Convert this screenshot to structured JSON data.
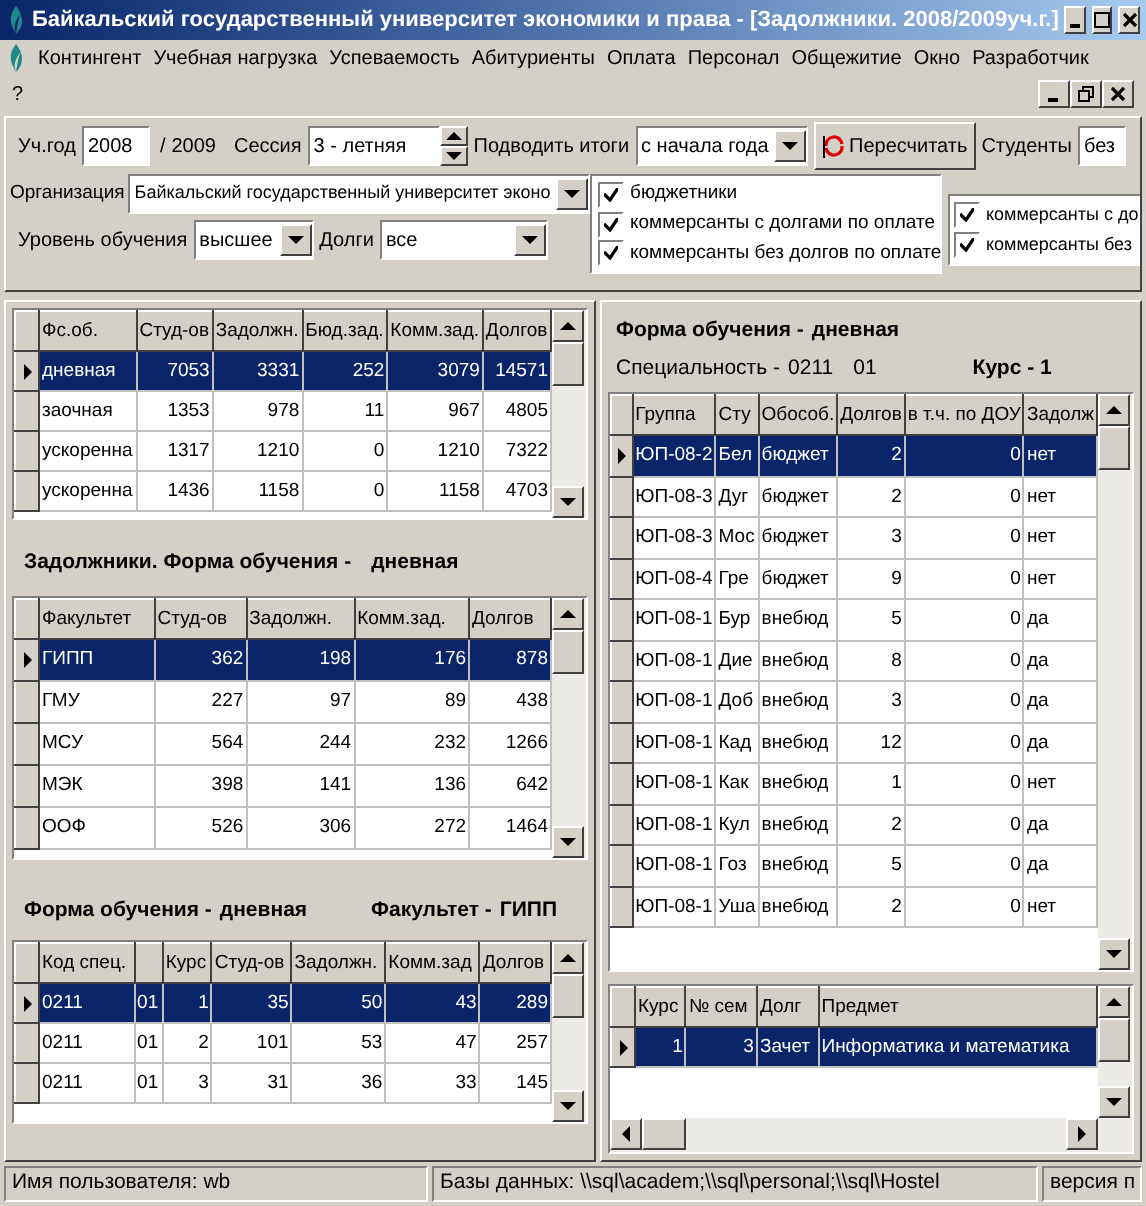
{
  "window": {
    "title": "Байкальский государственный университет экономики и права - [Задолжники. 2008/2009уч.г.]"
  },
  "menu": [
    "Контингент",
    "Учебная нагрузка",
    "Успеваемость",
    "Абитуриенты",
    "Оплата",
    "Персонал",
    "Общежитие",
    "Окно",
    "Разработчик"
  ],
  "menu_help": "?",
  "filters": {
    "year_label": "Уч.год",
    "year": "2008",
    "year_sep": "/",
    "year_end": "2009",
    "session_label": "Сессия",
    "session": "3 - летняя",
    "totals_label": "Подводить итоги",
    "totals": "с начала года",
    "recalc_button": "Пересчитать",
    "students_label": "Студенты",
    "students": "без",
    "org_label": "Организация",
    "org": "Байкальский государственный университет эконо",
    "level_label": "Уровень обучения",
    "level": "высшее",
    "debts_label": "Долги",
    "debts": "все"
  },
  "checkboxes": [
    {
      "label": "бюджетники",
      "checked": true
    },
    {
      "label": "коммерсанты с долгами по оплате",
      "checked": true
    },
    {
      "label": "коммерсанты без долгов по оплате",
      "checked": true
    }
  ],
  "checkboxes_2": [
    {
      "label": "коммерсанты с до",
      "checked": true
    },
    {
      "label": "коммерсанты без",
      "checked": true
    }
  ],
  "forms_table": {
    "columns": [
      "Фс.об.",
      "Студ-ов",
      "Задолжн.",
      "Бюд.зад.",
      "Комм.зад.",
      "Долгов"
    ],
    "rows": [
      {
        "cells": [
          "дневная",
          "7053",
          "3331",
          "252",
          "3079",
          "14571"
        ],
        "selected": true
      },
      {
        "cells": [
          "заочная",
          "1353",
          "978",
          "11",
          "967",
          "4805"
        ],
        "selected": false
      },
      {
        "cells": [
          "ускоренна",
          "1317",
          "1210",
          "0",
          "1210",
          "7322"
        ],
        "selected": false
      },
      {
        "cells": [
          "ускоренна",
          "1436",
          "1158",
          "0",
          "1158",
          "4703"
        ],
        "selected": false
      }
    ]
  },
  "faculty_caption": {
    "text": "Задолжники. Форма обучения -",
    "value": "дневная"
  },
  "faculty_table": {
    "columns": [
      "Факультет",
      "Студ-ов",
      "Задолжн.",
      "Комм.зад.",
      "Долгов"
    ],
    "rows": [
      {
        "cells": [
          "ГИПП",
          "362",
          "198",
          "176",
          "878"
        ],
        "selected": true
      },
      {
        "cells": [
          "ГМУ",
          "227",
          "97",
          "89",
          "438"
        ],
        "selected": false
      },
      {
        "cells": [
          "МСУ",
          "564",
          "244",
          "232",
          "1266"
        ],
        "selected": false
      },
      {
        "cells": [
          "МЭК",
          "398",
          "141",
          "136",
          "642"
        ],
        "selected": false
      },
      {
        "cells": [
          "ООФ",
          "526",
          "306",
          "272",
          "1464"
        ],
        "selected": false
      }
    ]
  },
  "spec_caption": {
    "form_label": "Форма обучения -",
    "form": "дневная",
    "faculty_label": "Факультет -",
    "faculty": "ГИПП"
  },
  "spec_table": {
    "columns": [
      "Код спец.",
      "",
      "Курс",
      "Студ-ов",
      "Задолжн.",
      "Комм.зад",
      "Долгов"
    ],
    "rows": [
      {
        "cells": [
          "0211",
          "01",
          "1",
          "35",
          "50",
          "43",
          "289"
        ],
        "selected": true
      },
      {
        "cells": [
          "0211",
          "01",
          "2",
          "101",
          "53",
          "47",
          "257"
        ],
        "selected": false
      },
      {
        "cells": [
          "0211",
          "01",
          "3",
          "31",
          "36",
          "33",
          "145"
        ],
        "selected": false
      }
    ]
  },
  "group_caption": {
    "form_label": "Форма обучения -",
    "form": "дневная",
    "spec_label": "Специальность -",
    "spec": "0211",
    "spec_sub": "01",
    "course": "Курс - 1"
  },
  "group_table": {
    "columns": [
      "Группа",
      "Сту",
      "Обособ.",
      "Долгов",
      "в т.ч. по ДОУ",
      "Задолж"
    ],
    "rows": [
      {
        "cells": [
          "ЮП-08-2",
          "Бел",
          "бюджет",
          "2",
          "0",
          "нет"
        ],
        "selected": true
      },
      {
        "cells": [
          "ЮП-08-3",
          "Дуг",
          "бюджет",
          "2",
          "0",
          "нет"
        ],
        "selected": false
      },
      {
        "cells": [
          "ЮП-08-3",
          "Мос",
          "бюджет",
          "3",
          "0",
          "нет"
        ],
        "selected": false
      },
      {
        "cells": [
          "ЮП-08-4",
          "Гре",
          "бюджет",
          "9",
          "0",
          "нет"
        ],
        "selected": false
      },
      {
        "cells": [
          "ЮП-08-1",
          "Бур",
          "внебюд",
          "5",
          "0",
          "да"
        ],
        "selected": false
      },
      {
        "cells": [
          "ЮП-08-1",
          "Дие",
          "внебюд",
          "8",
          "0",
          "да"
        ],
        "selected": false
      },
      {
        "cells": [
          "ЮП-08-1",
          "Доб",
          "внебюд",
          "3",
          "0",
          "да"
        ],
        "selected": false
      },
      {
        "cells": [
          "ЮП-08-1",
          "Кад",
          "внебюд",
          "12",
          "0",
          "да"
        ],
        "selected": false
      },
      {
        "cells": [
          "ЮП-08-1",
          "Как",
          "внебюд",
          "1",
          "0",
          "нет"
        ],
        "selected": false
      },
      {
        "cells": [
          "ЮП-08-1",
          "Кул",
          "внебюд",
          "2",
          "0",
          "да"
        ],
        "selected": false
      },
      {
        "cells": [
          "ЮП-08-1",
          "Гоз",
          "внебюд",
          "5",
          "0",
          "да"
        ],
        "selected": false
      },
      {
        "cells": [
          "ЮП-08-1",
          "Уша",
          "внебюд",
          "2",
          "0",
          "нет"
        ],
        "selected": false
      }
    ]
  },
  "debt_table": {
    "columns": [
      "Курс",
      "№ сем",
      "Долг",
      "Предмет"
    ],
    "rows": [
      {
        "cells": [
          "1",
          "3",
          "Зачет",
          "Информатика и математика"
        ],
        "selected": true
      }
    ]
  },
  "status_bar": {
    "user": "Имя пользователя: wb",
    "databases": "Базы данных: \\\\sql\\academ;\\\\sql\\personal;\\\\sql\\Hostel",
    "version": "версия п"
  }
}
